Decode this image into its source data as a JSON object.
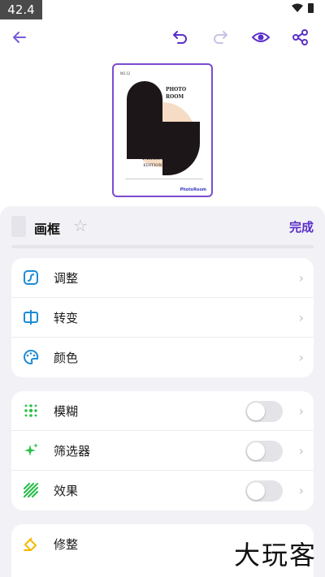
{
  "status": {
    "time": "42.4"
  },
  "sheet": {
    "title": "画框",
    "done_label": "完成"
  },
  "groups": {
    "basic": [
      {
        "label": "调整",
        "icon": "adjust-icon"
      },
      {
        "label": "转变",
        "icon": "transform-icon"
      },
      {
        "label": "颜色",
        "icon": "palette-icon"
      }
    ],
    "effects": [
      {
        "label": "模糊",
        "icon": "blur-icon",
        "enabled": false
      },
      {
        "label": "筛选器",
        "icon": "sparkle-icon",
        "enabled": false
      },
      {
        "label": "效果",
        "icon": "effects-stripes-icon",
        "enabled": false
      }
    ],
    "retouch": [
      {
        "label": "修整",
        "icon": "retouch-icon"
      }
    ]
  },
  "poster": {
    "small_text": "NO.12",
    "title_line1": "PHOTO",
    "title_line2": "ROOM",
    "subtitle_line1": "FASHION",
    "subtitle_line2": "EDITION",
    "brand": "PhotoRoom"
  },
  "watermark": "大玩客",
  "colors": {
    "accent": "#5b2fc9",
    "blue": "#1c8bd6",
    "green": "#2bbf4a",
    "yellow": "#f5b800"
  }
}
